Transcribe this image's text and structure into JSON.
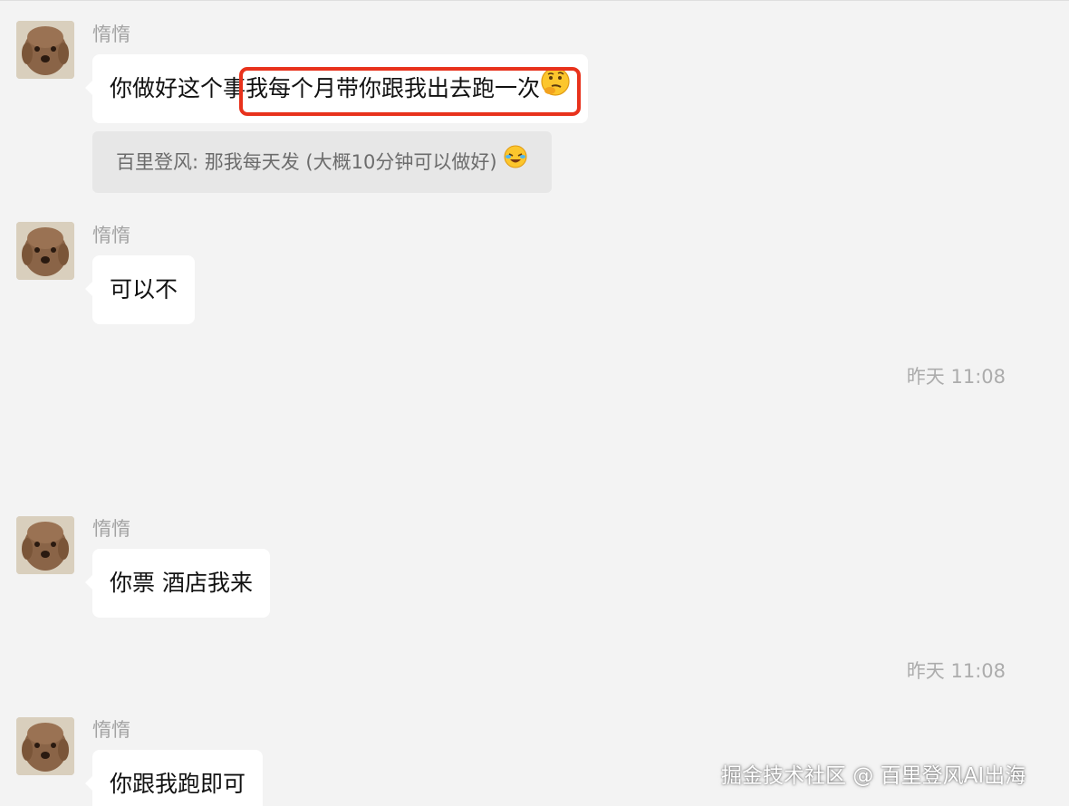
{
  "messages": [
    {
      "sender": "惰惰",
      "text_before": "你做好这个事",
      "highlight_text": "我每个月带你跟我出去跑一次",
      "emoji": "thinking-face",
      "quote": {
        "text": "百里登风: 那我每天发 (大概10分钟可以做好)",
        "emoji": "rolling-laughing-face"
      }
    },
    {
      "sender": "惰惰",
      "text": "可以不"
    },
    {
      "timestamp": "昨天 11:08"
    },
    {
      "sender": "惰惰",
      "text": "你票 酒店我来"
    },
    {
      "timestamp": "昨天 11:08"
    },
    {
      "sender": "惰惰",
      "text": "你跟我跑即可"
    }
  ],
  "colors": {
    "background": "#f3f3f3",
    "bubble": "#ffffff",
    "quote_bg": "#e7e7e7",
    "highlight_border": "#e8321c"
  },
  "watermark": "掘金技术社区 @ 百里登风AI出海"
}
